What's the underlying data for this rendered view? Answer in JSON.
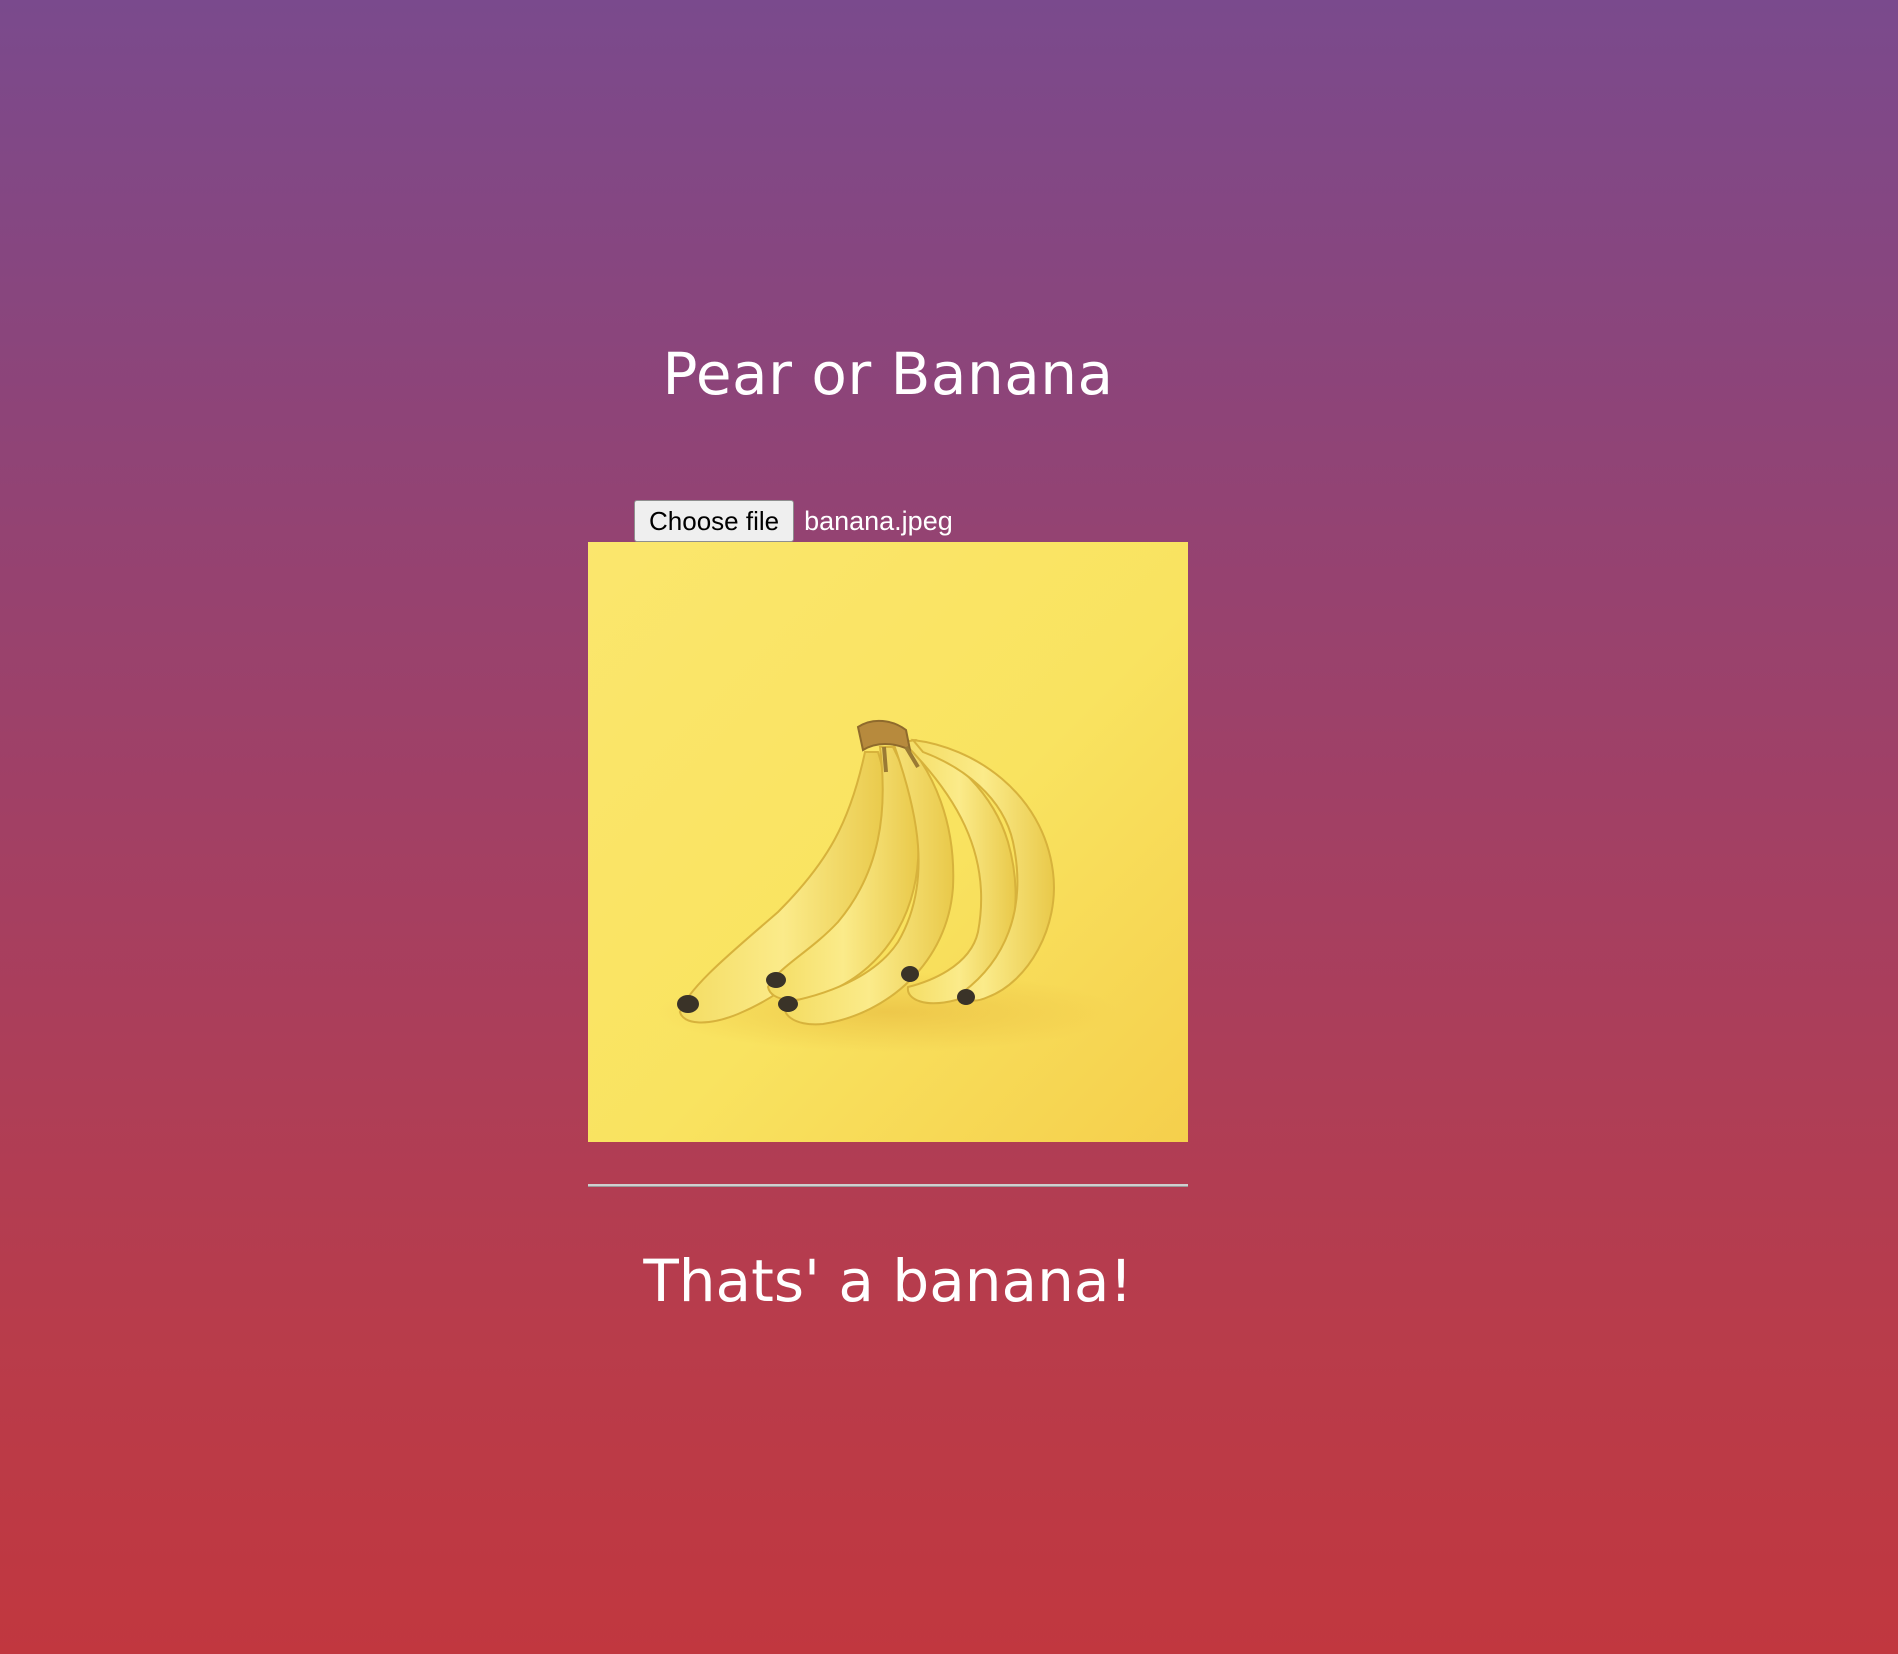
{
  "page": {
    "title": "Pear or Banana",
    "background_colors": [
      "#7a4a8d",
      "#c1373f"
    ]
  },
  "upload": {
    "button_label": "Choose file",
    "file_name": "banana.jpeg"
  },
  "preview": {
    "subject": "bunch of bananas on yellow background",
    "background_color": "#f8df5c"
  },
  "prediction": {
    "text": "Thats' a banana!"
  }
}
